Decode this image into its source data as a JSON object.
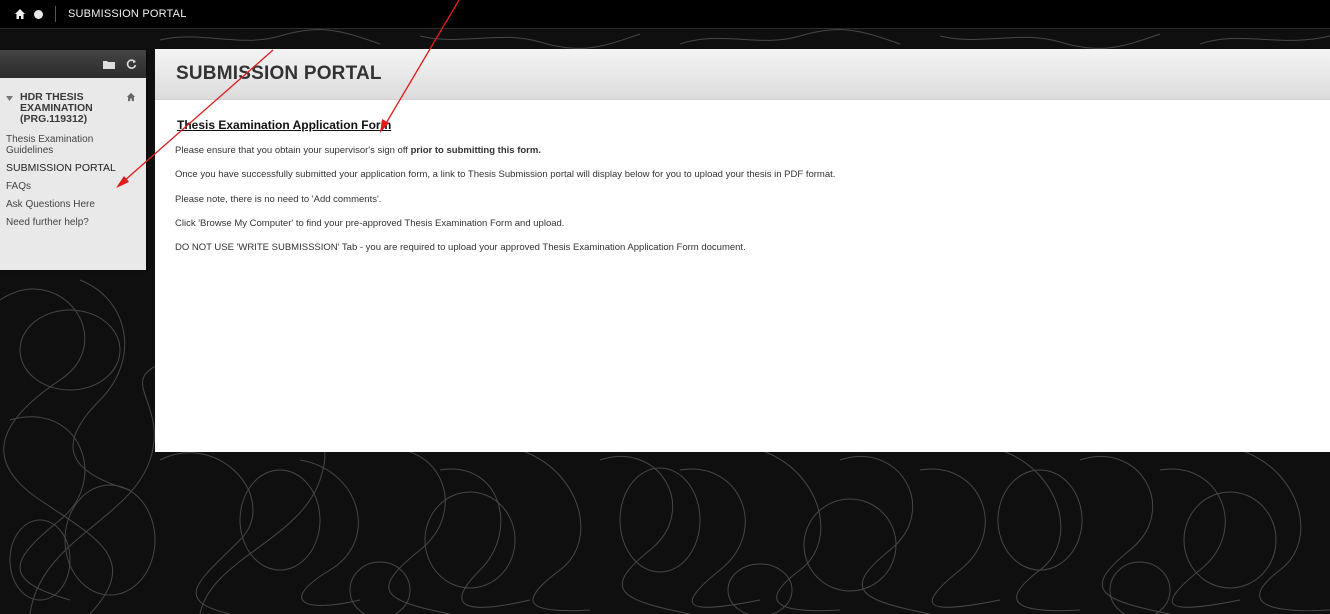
{
  "topbar": {
    "breadcrumb": "SUBMISSION PORTAL"
  },
  "icons": {
    "home": "home-icon",
    "status": "circle-icon",
    "folder": "folder-icon",
    "refresh": "refresh-icon",
    "expand": "triangle-down-icon",
    "course_home": "home-icon"
  },
  "menu": {
    "course_title_line1": "HDR THESIS",
    "course_title_line2": "EXAMINATION",
    "course_title_line3": "(PRG.119312)",
    "items": [
      {
        "label_line1": "Thesis Examination",
        "label_line2": "Guidelines"
      },
      {
        "label_line1": "SUBMISSION PORTAL",
        "label_line2": ""
      },
      {
        "label_line1": "FAQs",
        "label_line2": ""
      },
      {
        "label_line1": "Ask Questions Here",
        "label_line2": ""
      },
      {
        "label_line1": "Need further help?",
        "label_line2": ""
      }
    ]
  },
  "content": {
    "page_title": "SUBMISSION PORTAL",
    "item_title": "Thesis Examination Application Form",
    "para1_normal": "Please ensure that you obtain your supervisor's sign off ",
    "para1_bold": "prior to submitting this form.",
    "para2": "Once you have successfully submitted your application form, a link to Thesis Submission portal will display below for you to upload your thesis in PDF format.",
    "para3": "Please note, there is no need to 'Add comments'.",
    "para4": "Click 'Browse My Computer' to find your pre-approved Thesis Examination Form and upload.",
    "para5": "DO NOT USE 'WRITE SUBMISSSION' Tab - you are required to upload your approved Thesis Examination Application Form document."
  },
  "colors": {
    "background": "#0d0d0d",
    "topbar": "#000000",
    "panel": "#ffffff",
    "annotation": "#e31b1b"
  }
}
